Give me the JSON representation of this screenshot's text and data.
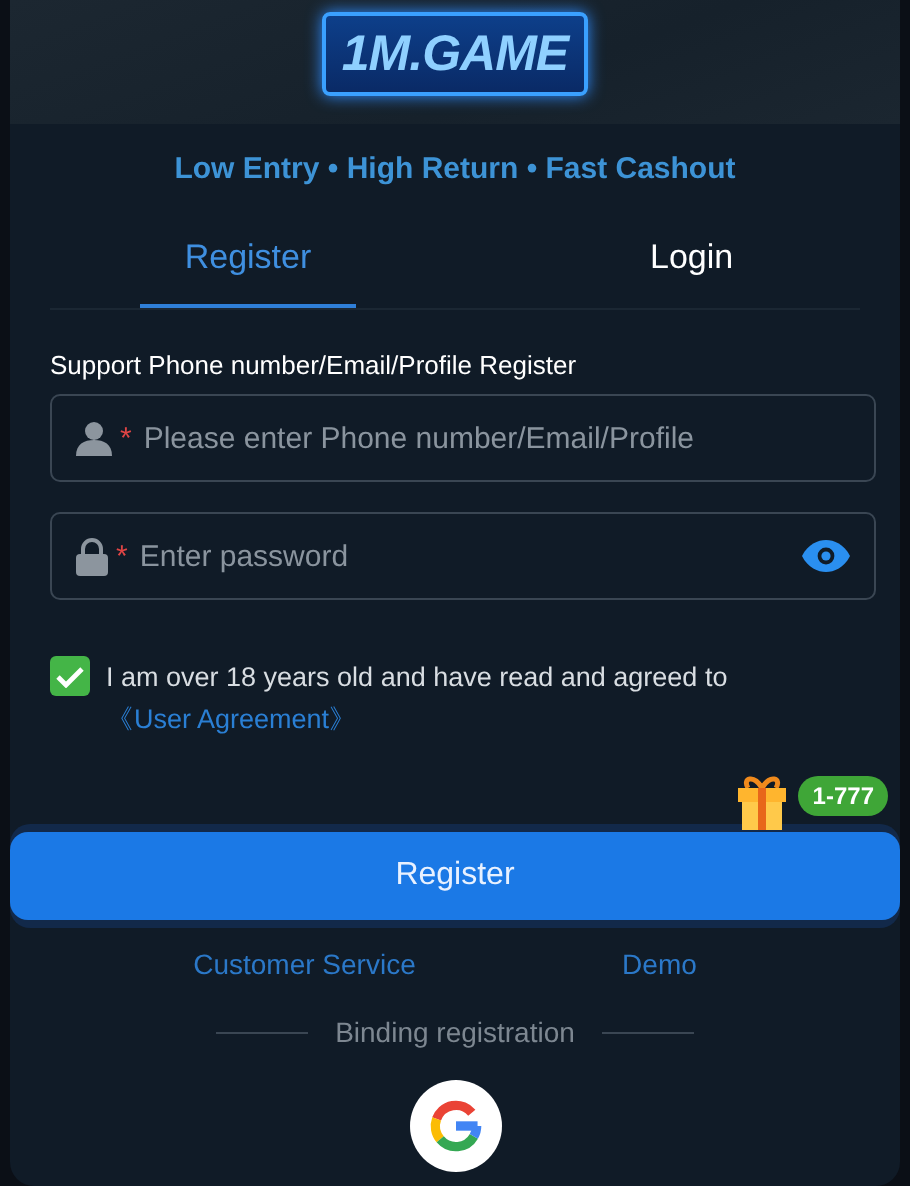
{
  "logo": {
    "text": "1M.GAME"
  },
  "tagline": "Low Entry • High Return • Fast Cashout",
  "tabs": [
    {
      "label": "Register",
      "selected": true
    },
    {
      "label": "Login",
      "selected": false
    }
  ],
  "form_title": "Support Phone number/Email/Profile Register",
  "fields": [
    {
      "kind": "account",
      "required_mark": "*",
      "placeholder": "Please enter Phone number/Email/Profile"
    },
    {
      "kind": "password",
      "required_mark": "*",
      "placeholder": "Enter password"
    }
  ],
  "agreement": {
    "checked": true,
    "text": "I am over 18 years old and have read and agreed to",
    "link": "《User Agreement》"
  },
  "bonus_badge": "1-777",
  "register_button": "Register",
  "links": [
    "Customer Service",
    "Demo"
  ],
  "divider_label": "Binding registration"
}
